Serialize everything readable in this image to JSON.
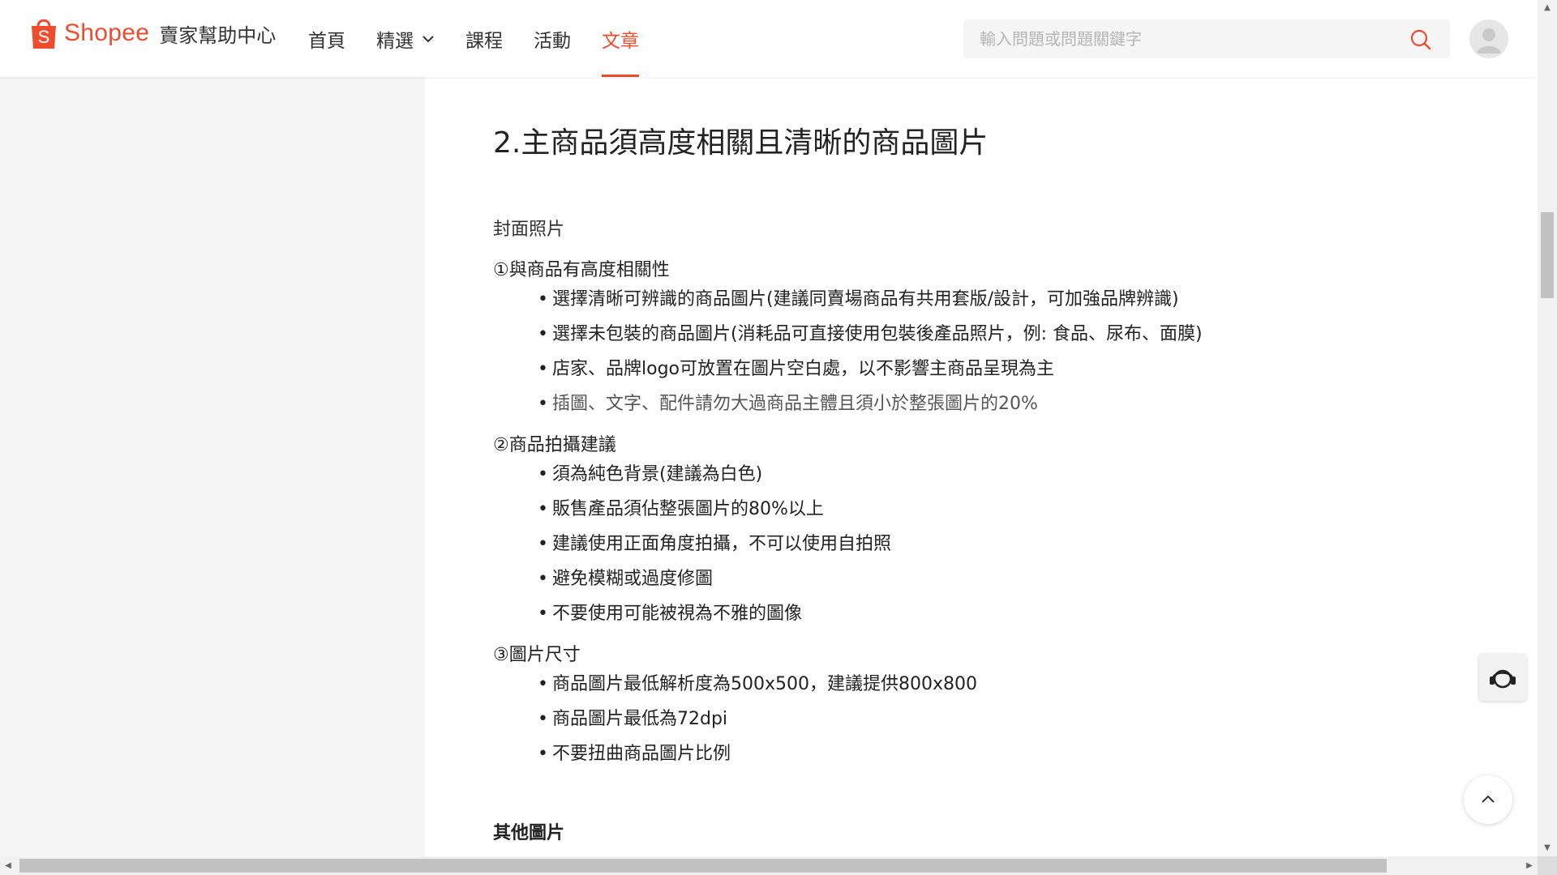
{
  "brand": {
    "name": "Shopee",
    "subtitle": "賣家幫助中心",
    "color": "#ee4d2d"
  },
  "nav": [
    {
      "label": "首頁",
      "active": false
    },
    {
      "label": "精選",
      "active": false,
      "dropdown": true
    },
    {
      "label": "課程",
      "active": false
    },
    {
      "label": "活動",
      "active": false
    },
    {
      "label": "文章",
      "active": true
    }
  ],
  "search": {
    "placeholder": "輸入問題或問題關鍵字",
    "value": ""
  },
  "article": {
    "heading": "2.主商品須高度相關且清晰的商品圖片",
    "subheading": "封面照片",
    "sections": [
      {
        "title": "①與商品有高度相關性",
        "items": [
          "選擇清晰可辨識的商品圖片(建議同賣場商品有共用套版/設計，可加強品牌辨識)",
          "選擇未包裝的商品圖片(消耗品可直接使用包裝後產品照片，例: 食品、尿布、面膜)",
          "店家、品牌logo可放置在圖片空白處，以不影響主商品呈現為主",
          "插圖、文字、配件請勿大過商品主體且須小於整張圖片的20%"
        ]
      },
      {
        "title": "②商品拍攝建議",
        "items": [
          "須為純色背景(建議為白色)",
          "販售產品須佔整張圖片的80%以上",
          "建議使用正面角度拍攝，不可以使用自拍照",
          "避免模糊或過度修圖",
          "不要使用可能被視為不雅的圖像"
        ]
      },
      {
        "title": "③圖片尺寸",
        "items": [
          "商品圖片最低解析度為500x500，建議提供800x800",
          "商品圖片最低為72dpi",
          "不要扭曲商品圖片比例"
        ]
      }
    ],
    "next_heading": "其他圖片"
  },
  "icons": {
    "logo": "shopee-bag-icon",
    "search": "search-icon",
    "avatar": "user-avatar-icon",
    "chat": "customer-service-icon",
    "back_to_top": "chevron-up-icon"
  }
}
